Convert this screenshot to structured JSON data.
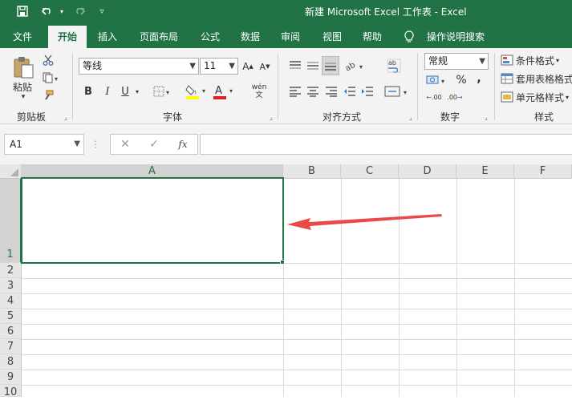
{
  "titlebar": {
    "title": "新建 Microsoft Excel 工作表  -  Excel",
    "icons": [
      "save-icon",
      "undo-icon",
      "redo-icon",
      "customize-qat-icon"
    ]
  },
  "tabs": [
    {
      "label": "文件",
      "active": false
    },
    {
      "label": "开始",
      "active": true
    },
    {
      "label": "插入",
      "active": false
    },
    {
      "label": "页面布局",
      "active": false
    },
    {
      "label": "公式",
      "active": false
    },
    {
      "label": "数据",
      "active": false
    },
    {
      "label": "审阅",
      "active": false
    },
    {
      "label": "视图",
      "active": false
    },
    {
      "label": "帮助",
      "active": false
    }
  ],
  "tell_me": "操作说明搜索",
  "ribbon": {
    "clipboard": {
      "paste_label": "粘贴",
      "group_label": "剪贴板"
    },
    "font": {
      "name": "等线",
      "size": "11",
      "group_label": "字体",
      "bold": "B",
      "italic": "I",
      "underline": "U",
      "phonetic": "wén 文"
    },
    "alignment": {
      "group_label": "对齐方式"
    },
    "number": {
      "format": "常规",
      "group_label": "数字",
      "percent": "%",
      "comma": ",",
      "inc_decimal": ".00",
      "dec_decimal": ".00"
    },
    "styles": {
      "conditional": "条件格式",
      "table": "套用表格格式",
      "cell": "单元格样式",
      "group_label": "样式"
    }
  },
  "formula_bar": {
    "name_box": "A1",
    "fx": "fx",
    "formula": ""
  },
  "grid": {
    "columns": [
      "A",
      "B",
      "C",
      "D",
      "E",
      "F"
    ],
    "rows": [
      "1",
      "2",
      "3",
      "4",
      "5",
      "6",
      "7",
      "8",
      "9",
      "10"
    ],
    "selected_cell": "A1"
  },
  "colors": {
    "excel_green": "#217346",
    "annotation_arrow": "#e84a4a"
  }
}
